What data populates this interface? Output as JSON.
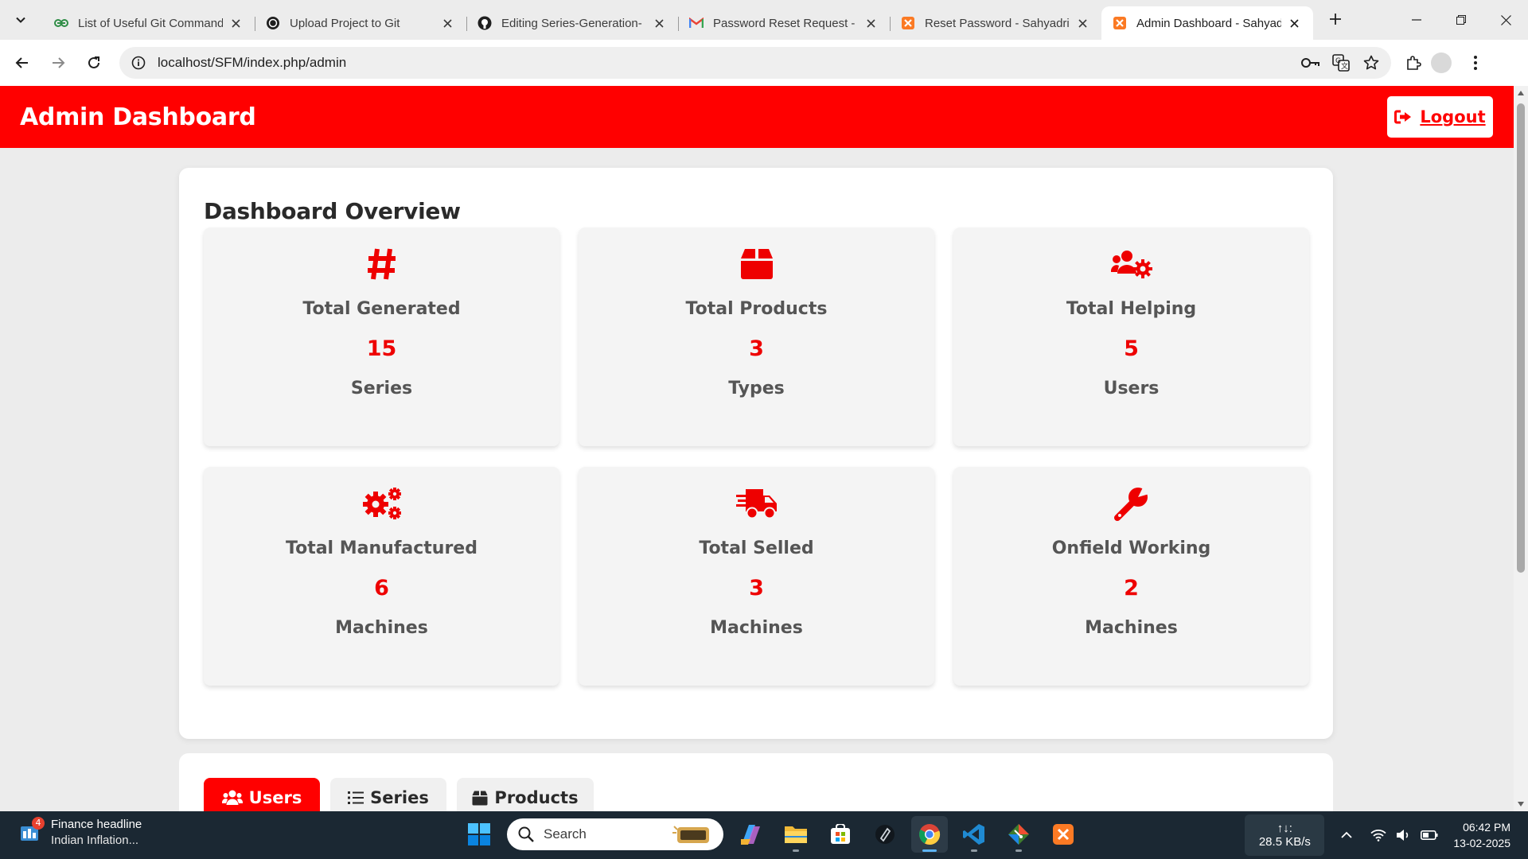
{
  "browser": {
    "tabs": [
      {
        "title": "List of Useful Git Commands",
        "favicon": "geeksforgeeks-icon",
        "active": false
      },
      {
        "title": "Upload Project to Git",
        "favicon": "chatgpt-icon",
        "active": false
      },
      {
        "title": "Editing Series-Generation-",
        "favicon": "github-icon",
        "active": false
      },
      {
        "title": "Password Reset Request - ",
        "favicon": "gmail-icon",
        "active": false
      },
      {
        "title": "Reset Password - Sahyadri",
        "favicon": "xampp-icon",
        "active": false
      },
      {
        "title": "Admin Dashboard - Sahyadri",
        "favicon": "xampp-icon",
        "active": true
      }
    ],
    "url": "localhost/SFM/index.php/admin"
  },
  "header": {
    "title": "Admin Dashboard",
    "logout_label": "Logout"
  },
  "overview": {
    "title": "Dashboard Overview",
    "cards": [
      {
        "icon": "hashtag-icon",
        "label": "Total Generated",
        "value": "15",
        "unit": "Series"
      },
      {
        "icon": "box-icon",
        "label": "Total Products",
        "value": "3",
        "unit": "Types"
      },
      {
        "icon": "users-cog-icon",
        "label": "Total Helping",
        "value": "5",
        "unit": "Users"
      },
      {
        "icon": "cogs-icon",
        "label": "Total Manufactured",
        "value": "6",
        "unit": "Machines"
      },
      {
        "icon": "shipping-fast-icon",
        "label": "Total Selled",
        "value": "3",
        "unit": "Machines"
      },
      {
        "icon": "wrench-icon",
        "label": "Onfield Working",
        "value": "2",
        "unit": "Machines"
      }
    ]
  },
  "panel_tabs": [
    {
      "label": "Users",
      "icon": "users-icon",
      "active": true
    },
    {
      "label": "Series",
      "icon": "list-icon",
      "active": false
    },
    {
      "label": "Products",
      "icon": "box-icon",
      "active": false
    }
  ],
  "taskbar": {
    "news_badge": "4",
    "news_title": "Finance headline",
    "news_subtitle": "Indian Inflation...",
    "search_placeholder": "Search",
    "net_arrows": "↑↓:",
    "net_speed": "28.5 KB/s",
    "time": "06:42 PM",
    "date": "13-02-2025"
  },
  "colors": {
    "brand_red": "#ff0000",
    "page_bg": "#ececec",
    "card_bg": "#f4f4f4",
    "taskbar_bg": "#1b2833"
  }
}
